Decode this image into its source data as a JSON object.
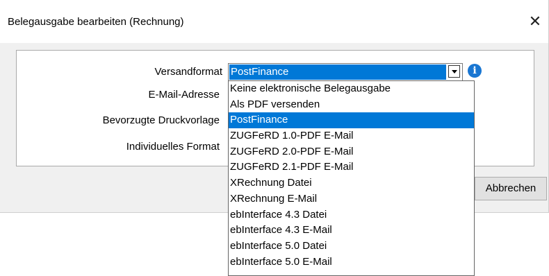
{
  "dialog": {
    "title": "Belegausgabe bearbeiten (Rechnung)",
    "close_glyph": "✕"
  },
  "form": {
    "versandformat_label": "Versandformat",
    "email_label": "E-Mail-Adresse",
    "druckvorlage_label": "Bevorzugte Druckvorlage",
    "format_label": "Individuelles Format",
    "versandformat_value": "PostFinance",
    "info_glyph": "i"
  },
  "buttons": {
    "cancel_label": "Abbrechen"
  },
  "dropdown": {
    "selected_index": 2,
    "options": [
      "Keine elektronische Belegausgabe",
      "Als PDF versenden",
      "PostFinance",
      "ZUGFeRD 1.0-PDF E-Mail",
      "ZUGFeRD 2.0-PDF E-Mail",
      "ZUGFeRD 2.1-PDF E-Mail",
      "XRechnung Datei",
      "XRechnung E-Mail",
      "ebInterface 4.3 Datei",
      "ebInterface 4.3 E-Mail",
      "ebInterface 5.0 Datei",
      "ebInterface 5.0 E-Mail"
    ]
  },
  "colors": {
    "accent": "#0078d7",
    "info": "#1976d2"
  },
  "icons": [
    "close-icon",
    "chevron-down-icon",
    "info-icon"
  ]
}
